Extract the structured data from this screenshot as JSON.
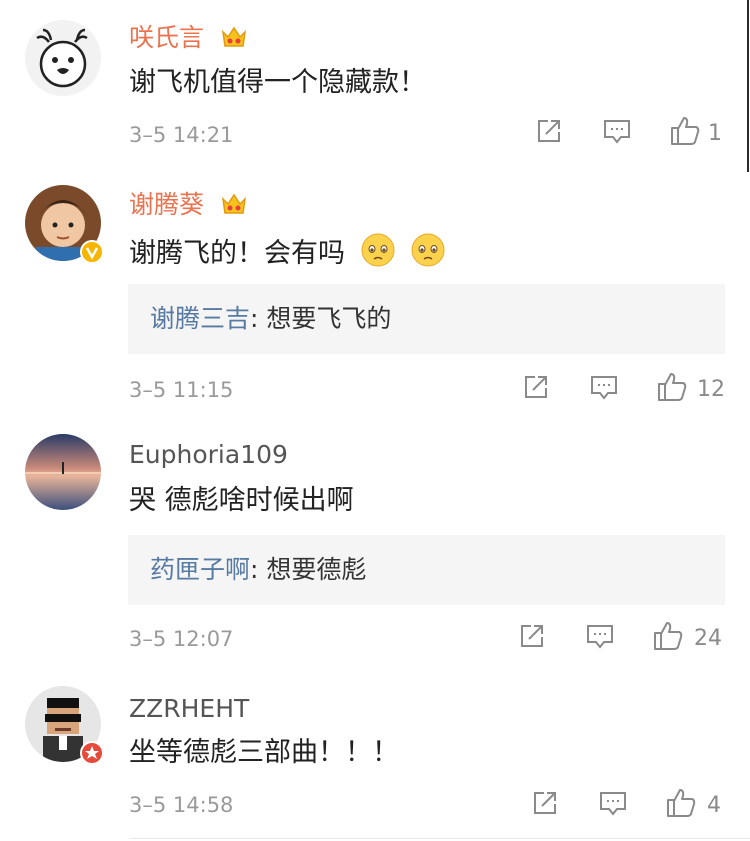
{
  "comments": [
    {
      "username": "咲氏言",
      "text": "谢飞机值得一个隐藏款！",
      "time": "3–5 14:21",
      "likes": "1",
      "has_crown": true,
      "avatar_icon": "cartoon-face-avatar-icon"
    },
    {
      "username": "谢腾葵",
      "text": "谢腾飞的！会有吗",
      "reply_name": "谢腾三吉",
      "reply_text": "想要飞飞的",
      "time": "3–5 11:15",
      "likes": "12",
      "has_crown": true,
      "verified": true,
      "avatar_icon": "child-photo-avatar-icon",
      "emojis": [
        "pleading-face-emoji",
        "pleading-face-emoji"
      ]
    },
    {
      "username": "Euphoria109",
      "text": "哭 德彪啥时候出啊",
      "reply_name": "药匣子啊",
      "reply_text": "想要德彪",
      "time": "3–5 12:07",
      "likes": "24",
      "avatar_icon": "sunset-lake-avatar-icon"
    },
    {
      "username": "ZZRHEHT",
      "text": "坐等德彪三部曲！！！",
      "time": "3–5 14:58",
      "likes": "4",
      "verified_red": true,
      "avatar_icon": "pixel-man-sunglasses-avatar-icon"
    }
  ],
  "reply_separator": ": ",
  "colors": {
    "vip_name": "#eb7350",
    "normal_name": "#555555",
    "reply_name": "#577aa3",
    "meta": "#9a9a9a",
    "reply_bg": "#f5f5f5"
  }
}
